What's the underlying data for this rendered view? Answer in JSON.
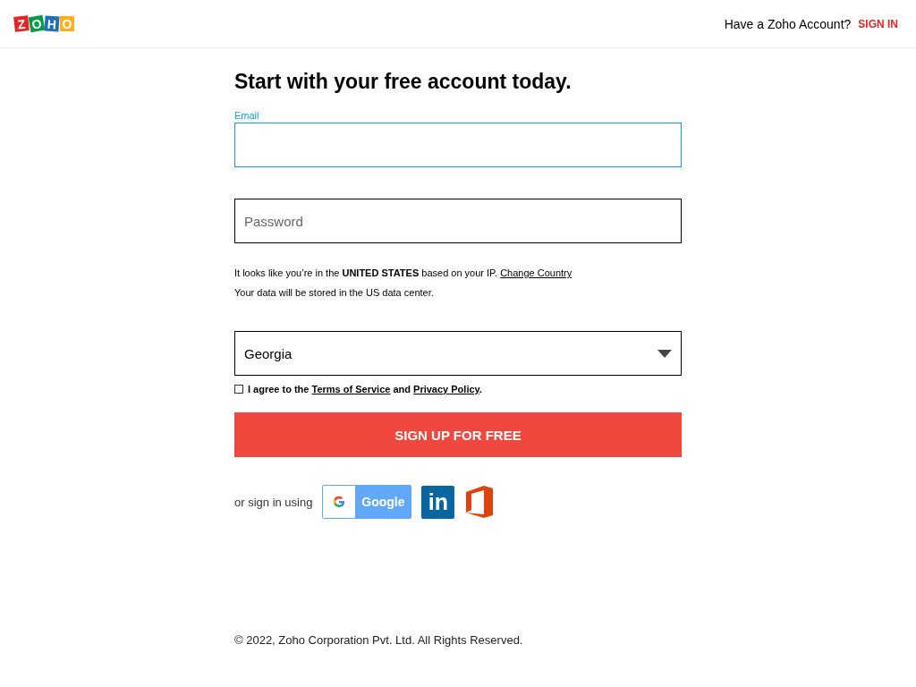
{
  "header": {
    "logo_letters": [
      {
        "letter": "Z",
        "color": "#e42527"
      },
      {
        "letter": "O",
        "color": "#089949"
      },
      {
        "letter": "H",
        "color": "#226db4"
      },
      {
        "letter": "O",
        "color": "#f9b21d"
      }
    ],
    "prompt": "Have a Zoho Account?",
    "sign_in": "SIGN IN"
  },
  "title": "Start with your free account today.",
  "email": {
    "label": "Email",
    "focused": true
  },
  "password": {
    "placeholder": "Password"
  },
  "ip_notice": {
    "text": "It looks like you’re in the **UNITED STATES** based on your IP.",
    "link": "Change Country"
  },
  "storage_notice": "Your data will be stored in the US data center.",
  "state_select": {
    "value": "Georgia"
  },
  "agree": {
    "checked": false,
    "parts": [
      {
        "kind": "text",
        "text": "I agree to the"
      },
      {
        "kind": "link",
        "text": "Terms of Service"
      },
      {
        "kind": "text",
        "text": "and"
      },
      {
        "kind": "link",
        "text": "Privacy Policy"
      },
      {
        "kind": "text",
        "text": "."
      }
    ]
  },
  "submit": "SIGN UP FOR FREE",
  "social": {
    "label": "or sign in using",
    "providers": [
      {
        "kind": "google",
        "text": "Google"
      },
      {
        "kind": "linkedin",
        "text": "in"
      },
      {
        "kind": "office"
      }
    ]
  },
  "footer": "© 2022, Zoho Corporation Pvt. Ltd. All Rights Reserved."
}
